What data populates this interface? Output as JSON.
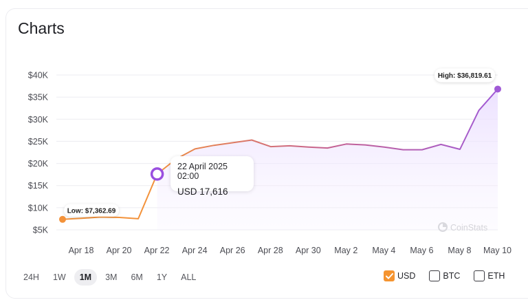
{
  "header": {
    "title": "Charts"
  },
  "chart_data": {
    "type": "line",
    "title": "",
    "xlabel": "",
    "ylabel": "",
    "ylim": [
      5000,
      40000
    ],
    "y_ticks": [
      {
        "value": 40000,
        "label": "$40K"
      },
      {
        "value": 35000,
        "label": "$35K"
      },
      {
        "value": 30000,
        "label": "$30K"
      },
      {
        "value": 25000,
        "label": "$25K"
      },
      {
        "value": 20000,
        "label": "$20K"
      },
      {
        "value": 15000,
        "label": "$15K"
      },
      {
        "value": 10000,
        "label": "$10K"
      },
      {
        "value": 5000,
        "label": "$5K"
      }
    ],
    "xlim": [
      17,
      40
    ],
    "x_ticks": [
      {
        "value": 18,
        "label": "Apr 18"
      },
      {
        "value": 20,
        "label": "Apr 20"
      },
      {
        "value": 22,
        "label": "Apr 22"
      },
      {
        "value": 24,
        "label": "Apr 24"
      },
      {
        "value": 26,
        "label": "Apr 26"
      },
      {
        "value": 28,
        "label": "Apr 28"
      },
      {
        "value": 30,
        "label": "Apr 30"
      },
      {
        "value": 32,
        "label": "May 2"
      },
      {
        "value": 34,
        "label": "May 4"
      },
      {
        "value": 36,
        "label": "May 6"
      },
      {
        "value": 38,
        "label": "May 8"
      },
      {
        "value": 40,
        "label": "May 10"
      }
    ],
    "x": [
      17,
      18,
      19,
      20,
      21,
      22,
      23,
      24,
      25,
      26,
      27,
      28,
      29,
      30,
      31,
      32,
      33,
      34,
      35,
      36,
      37,
      38,
      39,
      40
    ],
    "values": [
      7362.69,
      7600,
      7900,
      7800,
      7500,
      17616,
      21000,
      23300,
      24100,
      24700,
      25300,
      23800,
      24000,
      23700,
      23500,
      24400,
      24200,
      23700,
      23100,
      23100,
      24300,
      23200,
      32000,
      36819.61
    ],
    "low": {
      "index": 0,
      "label": "Low: $7,362.69"
    },
    "high": {
      "index": 23,
      "label": "High: $36,819.61"
    },
    "hover": {
      "index": 5
    },
    "colors": {
      "orange": "#f3923a",
      "purple": "#a05ad6",
      "mid": "#c25f98",
      "fill": "#f1eaff",
      "grid": "#ececf0",
      "axis": "#4a4b52"
    }
  },
  "tooltip": {
    "date": "22 April 2025 02:00",
    "value": "USD 17,616"
  },
  "watermark": "CoinStats",
  "ranges": [
    {
      "label": "24H",
      "active": false
    },
    {
      "label": "1W",
      "active": false
    },
    {
      "label": "1M",
      "active": true
    },
    {
      "label": "3M",
      "active": false
    },
    {
      "label": "6M",
      "active": false
    },
    {
      "label": "1Y",
      "active": false
    },
    {
      "label": "ALL",
      "active": false
    }
  ],
  "currencies": [
    {
      "label": "USD",
      "checked": true
    },
    {
      "label": "BTC",
      "checked": false
    },
    {
      "label": "ETH",
      "checked": false
    }
  ]
}
